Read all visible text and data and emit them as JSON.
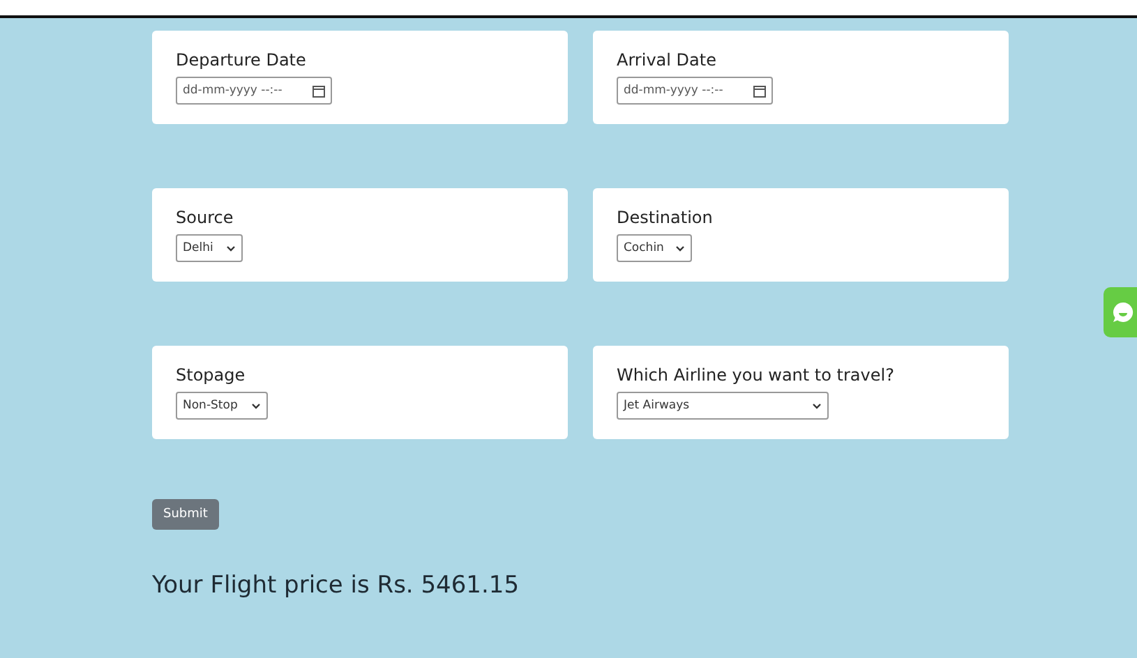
{
  "rows": [
    {
      "fields": [
        {
          "label": "Departure Date",
          "kind": "date",
          "placeholder": "dd-mm-yyyy --:--"
        },
        {
          "label": "Arrival Date",
          "kind": "date",
          "placeholder": "dd-mm-yyyy --:--"
        }
      ]
    },
    {
      "fields": [
        {
          "label": "Source",
          "kind": "select",
          "value": "Delhi"
        },
        {
          "label": "Destination",
          "kind": "select",
          "value": "Cochin"
        }
      ]
    },
    {
      "fields": [
        {
          "label": "Stopage",
          "kind": "select",
          "value": "Non-Stop"
        },
        {
          "label": "Which Airline you want to travel?",
          "kind": "wideselect",
          "value": "Jet Airways"
        }
      ]
    }
  ],
  "submit": "Submit",
  "result": "Your Flight price is Rs. 5461.15"
}
